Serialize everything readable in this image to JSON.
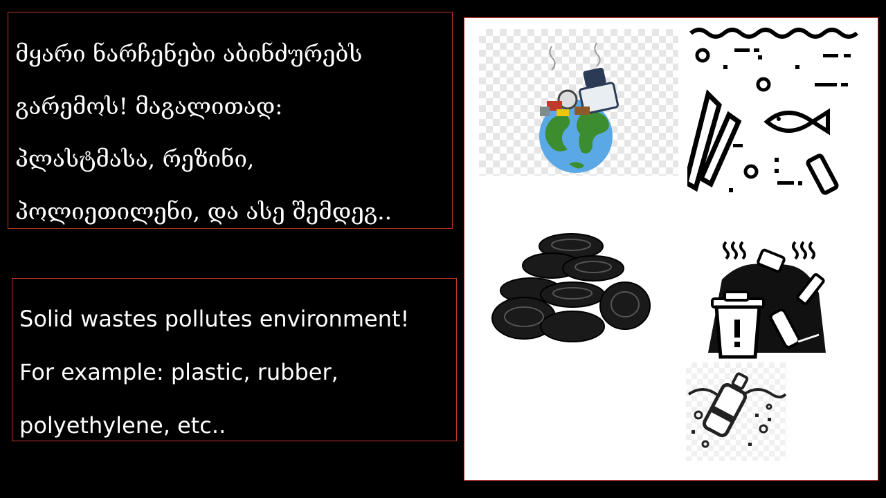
{
  "georgian_text": {
    "lines": [
      "მყარი ნარჩენები აბინძურებს",
      "გარემოს! მაგალითად:",
      "პლასტმასა, რეზინი,",
      "პოლიეთილენი, და ასე შემდეგ.."
    ]
  },
  "english_text": {
    "lines": [
      "Solid wastes pollutes environment!",
      "For example: plastic, rubber,",
      "polyethylene, etc.."
    ]
  },
  "images": [
    {
      "icon": "earth-garbage-icon"
    },
    {
      "icon": "ocean-pollution-icon"
    },
    {
      "icon": "tires-pile-icon"
    },
    {
      "icon": "waste-bin-icon"
    },
    {
      "icon": "bottle-in-water-icon"
    }
  ],
  "colors": {
    "background": "#000000",
    "text": "#ffffff",
    "box_border": "#c0392b",
    "panel": "#ffffff"
  }
}
